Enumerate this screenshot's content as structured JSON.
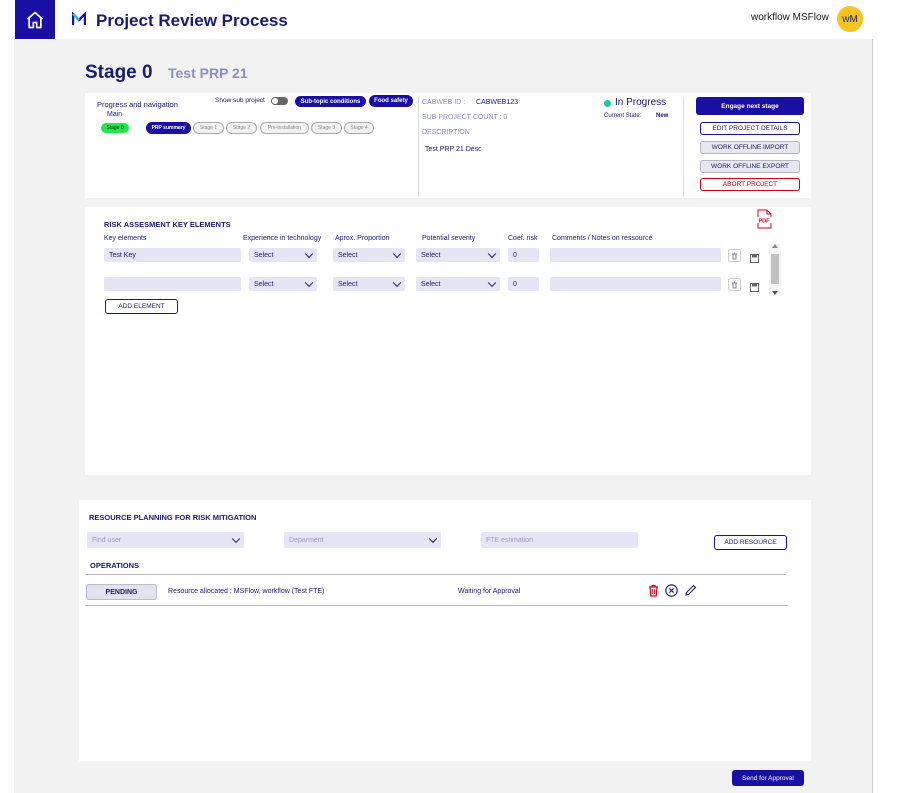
{
  "header": {
    "title": "Project Review Process",
    "user_name": "workflow MSFlow",
    "avatar_initials": "wM"
  },
  "stage": {
    "title": "Stage 0",
    "project_name": "Test PRP 21"
  },
  "progress": {
    "heading": "Progress and navigation",
    "main_label": "Main",
    "current_stage_pill": "Stage 0",
    "show_sub_project_label": "Show sub project",
    "chips": [
      "Sub-topic conditions",
      "Food safety"
    ],
    "steps": [
      "PRP summary",
      "Stage 1",
      "Stage 2",
      "Pre-installation",
      "Stage 3",
      "Stage 4"
    ]
  },
  "info": {
    "cabweb_label": "CABWEB ID :",
    "cabweb_value": "CABWEB123",
    "sub_count_label": "SUB PROJECT COUNT : 0",
    "description_label": "DESCRIPTION",
    "description_value": "Test PRP 21 Desc",
    "status": "In Progress",
    "status_color": "#1ec8a5",
    "current_state_label": "Current State:",
    "current_state_value": "New"
  },
  "actions": {
    "engage": "Engage next stage",
    "edit": "EDIT PROJECT DETAILS",
    "import": "WORK OFFLINE IMPORT",
    "export": "WORK OFFLINE EXPORT",
    "abort": "ABORT PROJECT"
  },
  "risk": {
    "title": "RISK ASSESMENT KEY ELEMENTS",
    "pdf_icon": "pdf-icon",
    "columns": [
      "Key elements",
      "Experience in technology",
      "Aprox. Proportion",
      "Potential severity",
      "Coef. risk",
      "Comments / Notes on ressource"
    ],
    "rows": [
      {
        "key": "Test Key",
        "experience": "Select",
        "proportion": "Select",
        "severity": "Select",
        "coef": "0",
        "comments": ""
      },
      {
        "key": "",
        "experience": "Select",
        "proportion": "Select",
        "severity": "Select",
        "coef": "0",
        "comments": ""
      }
    ],
    "add_button": "ADD ELEMENT"
  },
  "resource": {
    "title": "RESOURCE PLANNING FOR RISK MITIGATION",
    "find_user_placeholder": "Find user",
    "department_placeholder": "Deparment",
    "fte_placeholder": "FTE estimation",
    "add_button": "ADD RESOURCE",
    "operations_title": "OPERATIONS",
    "operation": {
      "status": "PENDING",
      "description": "Resource allocated : MSFlow, workflow (Test FTE)",
      "state": "Waiting for Approval"
    }
  },
  "footer": {
    "send_button": "Send for Approval"
  },
  "colors": {
    "primary": "#1a0fa3",
    "danger": "#d0021b",
    "success": "#22e64a",
    "avatar": "#f5c51d"
  }
}
